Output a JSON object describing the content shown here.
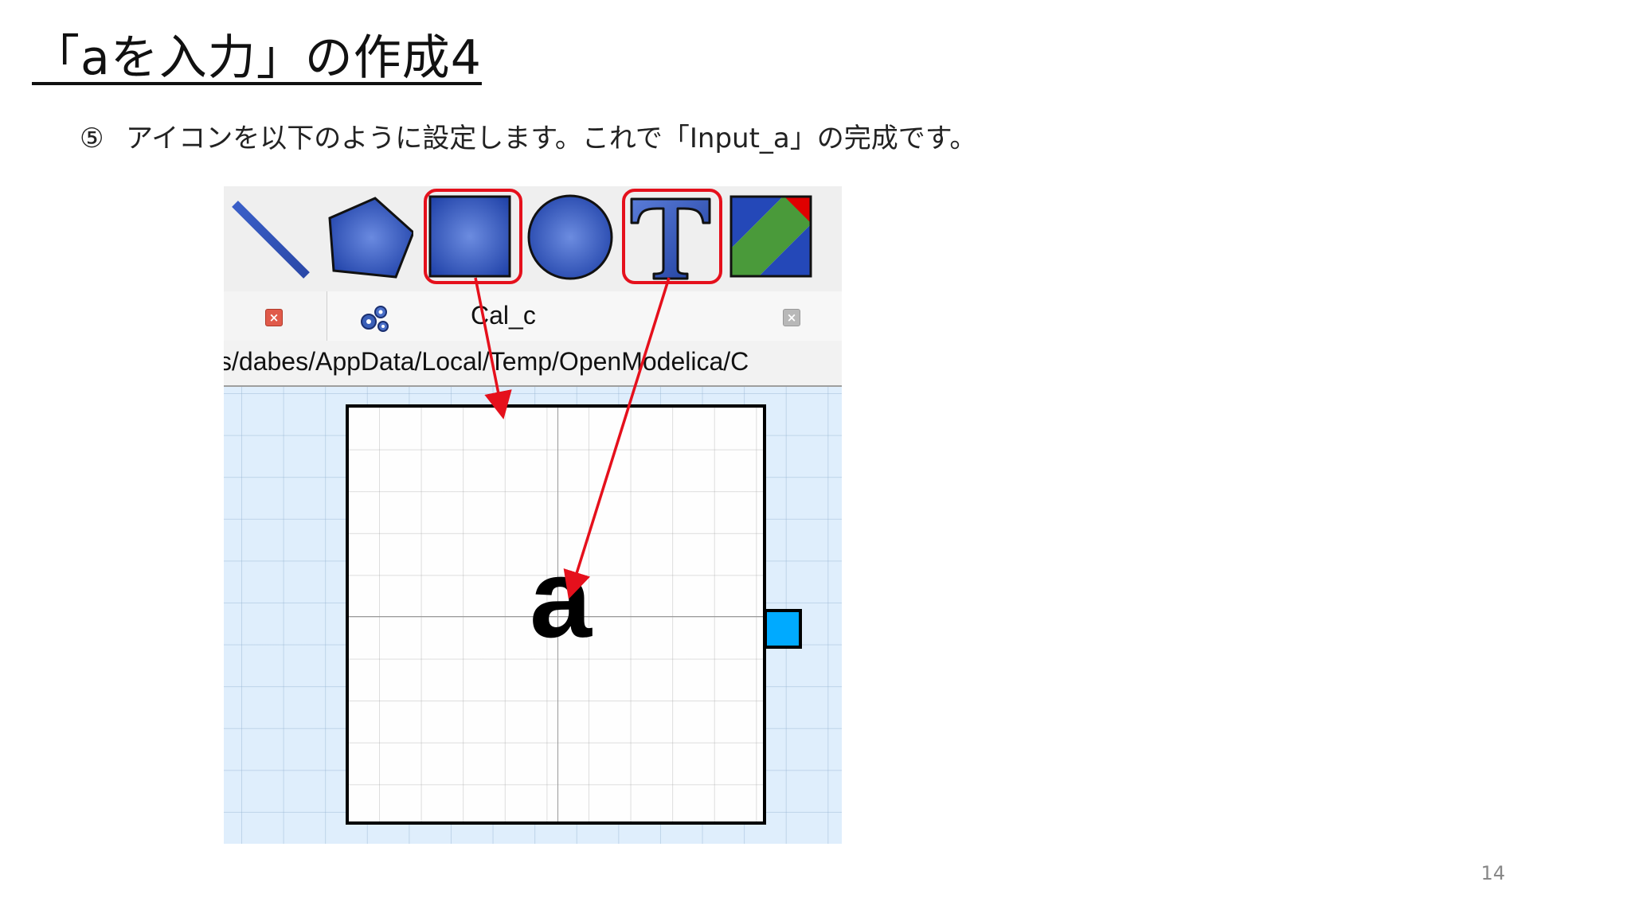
{
  "slide": {
    "title": "「aを入力」の作成4",
    "step_number": "⑤",
    "step_text": "アイコンを以下のように設定します。これで「Input_a」の完成です。",
    "page_number": "14"
  },
  "screenshot": {
    "toolbar": {
      "tools": [
        {
          "icon": "line-tool-icon",
          "highlighted": false
        },
        {
          "icon": "polygon-tool-icon",
          "highlighted": false
        },
        {
          "icon": "rectangle-tool-icon",
          "highlighted": true
        },
        {
          "icon": "ellipse-tool-icon",
          "highlighted": false
        },
        {
          "icon": "text-tool-icon",
          "highlighted": true
        },
        {
          "icon": "bitmap-tool-icon",
          "highlighted": false
        }
      ],
      "highlight_color": "#e5101c"
    },
    "tabs": {
      "model_tab_label": "Cal_c"
    },
    "path": "s/dabes/AppData/Local/Temp/OpenModelica/C",
    "canvas": {
      "icon_text": "a",
      "connector_color": "#00aaff"
    }
  }
}
